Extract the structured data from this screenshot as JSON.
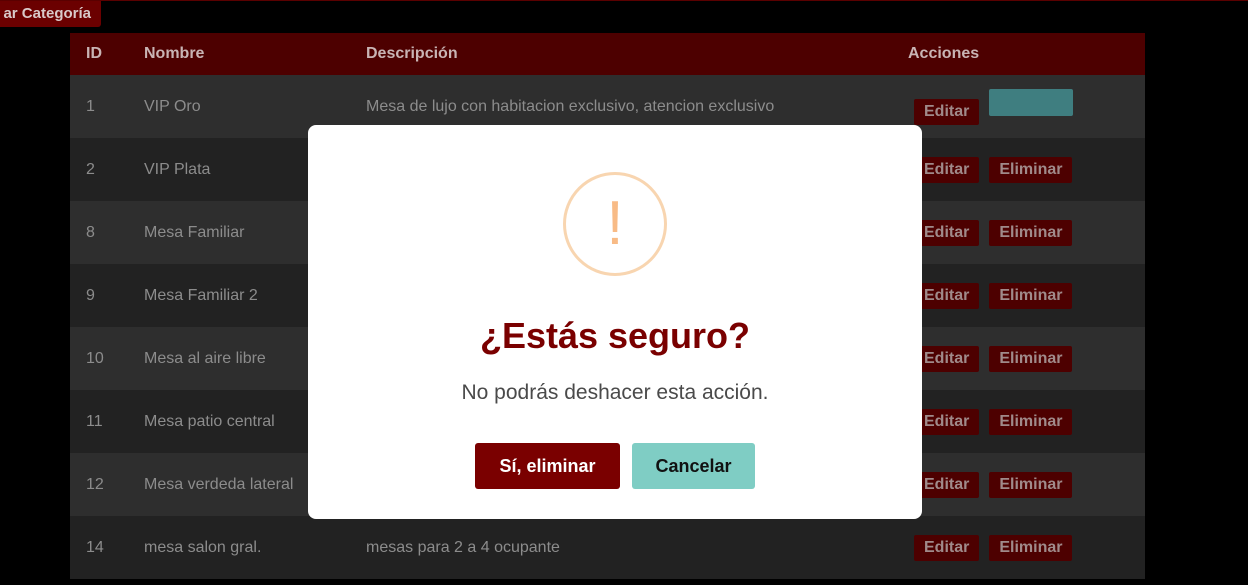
{
  "header": {
    "add_button_label": "ar Categoría"
  },
  "table": {
    "columns": [
      "ID",
      "Nombre",
      "Descripción",
      "Acciones"
    ],
    "rows": [
      {
        "id": "1",
        "name": "VIP Oro",
        "desc": "Mesa de lujo con habitacion exclusivo, atencion exclusivo",
        "edit": "Editar",
        "delete": ""
      },
      {
        "id": "2",
        "name": "VIP Plata",
        "desc": "",
        "edit": "Editar",
        "delete": "Eliminar"
      },
      {
        "id": "8",
        "name": "Mesa Familiar",
        "desc": "",
        "edit": "Editar",
        "delete": "Eliminar"
      },
      {
        "id": "9",
        "name": "Mesa Familiar 2",
        "desc": "",
        "edit": "Editar",
        "delete": "Eliminar"
      },
      {
        "id": "10",
        "name": "Mesa al aire libre",
        "desc": "",
        "edit": "Editar",
        "delete": "Eliminar"
      },
      {
        "id": "11",
        "name": "Mesa patio central",
        "desc": "",
        "edit": "Editar",
        "delete": "Eliminar"
      },
      {
        "id": "12",
        "name": "Mesa verdeda lateral",
        "desc": "",
        "edit": "Editar",
        "delete": "Eliminar"
      },
      {
        "id": "14",
        "name": "mesa salon gral.",
        "desc": "mesas para 2 a 4 ocupante",
        "edit": "Editar",
        "delete": "Eliminar"
      }
    ]
  },
  "modal": {
    "icon": "!",
    "icon_name": "warning-icon",
    "title": "¿Estás seguro?",
    "text": "No podrás deshacer esta acción.",
    "confirm_label": "Sí, eliminar",
    "cancel_label": "Cancelar"
  },
  "colors": {
    "accent": "#7a0000",
    "cancel": "#7fcdc4",
    "warning": "#f8bb86"
  }
}
